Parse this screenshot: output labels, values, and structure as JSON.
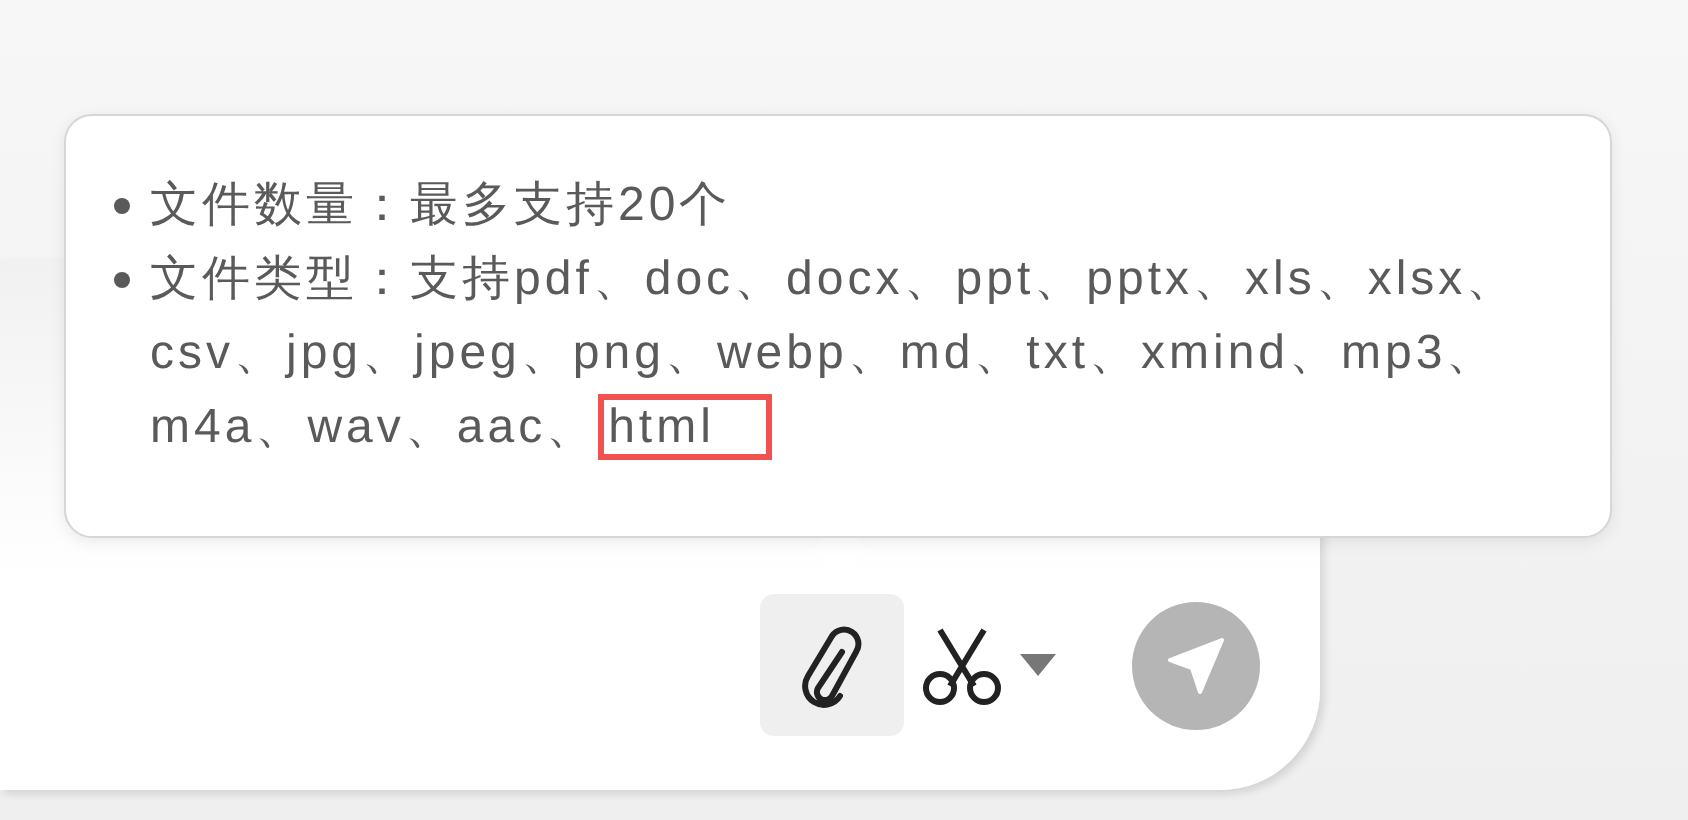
{
  "tooltip": {
    "items": [
      {
        "text": "文件数量：最多支持20个"
      },
      {
        "text": "文件类型：支持pdf、doc、docx、ppt、pptx、xls、xlsx、csv、jpg、jpeg、png、webp、md、txt、xmind、mp3、m4a、wav、aac、",
        "highlighted_text": "html"
      }
    ]
  },
  "toolbar": {
    "buttons": [
      {
        "kind": "attach",
        "selected": true,
        "disabled": false
      },
      {
        "kind": "scissors",
        "selected": false,
        "disabled": false
      },
      {
        "kind": "send",
        "selected": false,
        "disabled": true
      }
    ]
  }
}
